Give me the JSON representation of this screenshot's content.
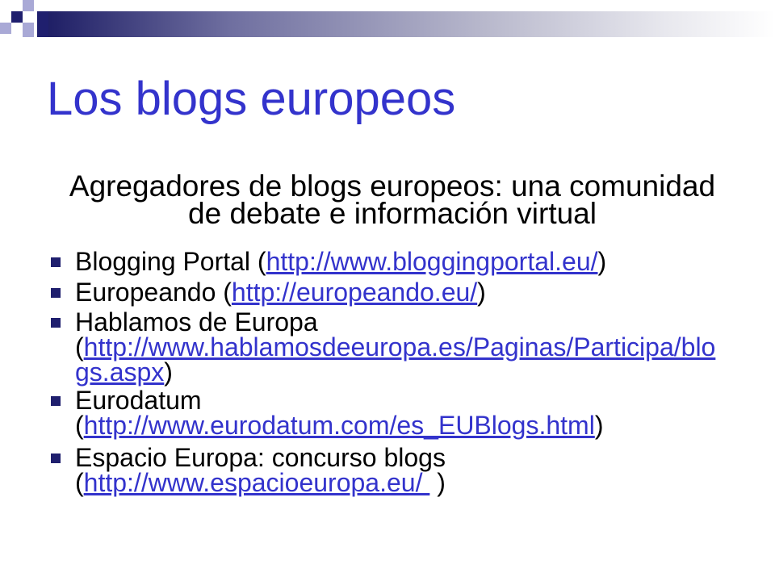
{
  "slide": {
    "title": "Los blogs europeos",
    "subtitle": {
      "line1": "Agregadores de blogs europeos: una comunidad",
      "line2": "de debate e información virtual"
    },
    "bullets": [
      {
        "prefix": "Blogging Portal (",
        "link": "http://www.bloggingportal.eu/",
        "suffix": ")"
      },
      {
        "prefix": "Europeando (",
        "link": "http://europeando.eu/",
        "suffix": ")"
      },
      {
        "label": "Hablamos de Europa",
        "prefix": "(",
        "link_part1": "http://www.hablamosdeeuropa.es/Paginas/Participa/blo",
        "link_part2": "gs.aspx",
        "suffix": ")"
      },
      {
        "label": "Eurodatum",
        "prefix": "(",
        "link": "http://www.eurodatum.com/es_EUBlogs.html",
        "suffix": ")"
      },
      {
        "label": "Espacio Europa: concurso blogs",
        "prefix": "(",
        "link": "http://www.espacioeuropa.eu/ ",
        "suffix": " )"
      }
    ]
  },
  "icons": {
    "bullet_marker": "square-bullet-icon"
  },
  "colors": {
    "title": "#3333CC",
    "link": "#3333CC",
    "bullet": "#1F1F6E",
    "text": "#000000",
    "navy": "#1F1F6E",
    "lavender": "#A9A9D6"
  }
}
